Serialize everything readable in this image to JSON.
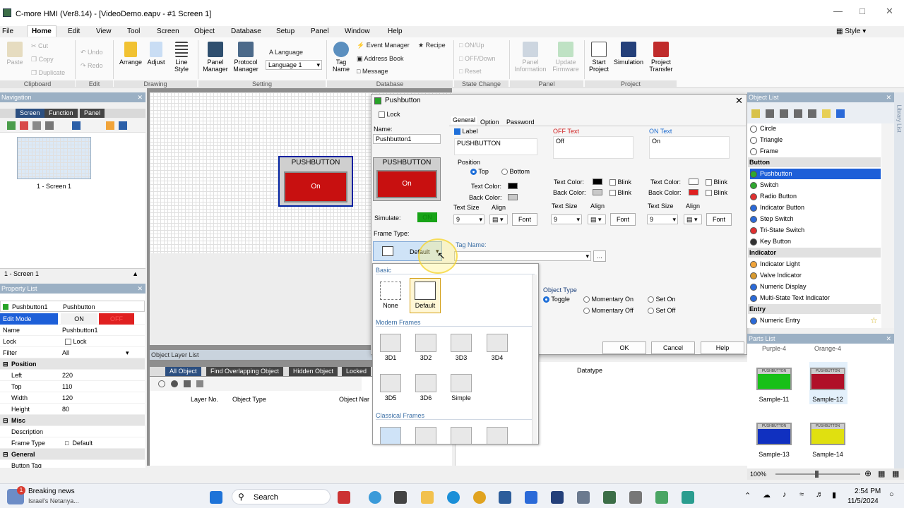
{
  "window": {
    "title": "C-more HMI (Ver8.14) - [VideoDemo.eapv - #1 Screen 1]",
    "style_label": "Style"
  },
  "menu": [
    "File",
    "Home",
    "Edit",
    "View",
    "Tool",
    "Screen",
    "Object",
    "Database",
    "Setup",
    "Panel",
    "Window",
    "Help"
  ],
  "ribbon": {
    "clipboard": {
      "paste": "Paste",
      "cut": "Cut",
      "copy": "Copy",
      "duplicate": "Duplicate",
      "label": "Clipboard"
    },
    "edit": {
      "undo": "Undo",
      "redo": "Redo",
      "label": "Edit"
    },
    "drawing": {
      "arrange": "Arrange",
      "adjust": "Adjust",
      "line_style": "Line Style",
      "label": "Drawing"
    },
    "setting": {
      "panel_manager": "Panel Manager",
      "protocol_manager": "Protocol Manager",
      "language_label": "Language",
      "language_value": "Language 1",
      "label": "Setting"
    },
    "database": {
      "tag_name": "Tag Name",
      "event_manager": "Event Manager",
      "recipe": "Recipe",
      "address_book": "Address Book",
      "message": "Message",
      "label": "Database"
    },
    "state_change": {
      "on_up": "ON/Up",
      "off_down": "OFF/Down",
      "reset": "Reset",
      "label": "State Change"
    },
    "panel": {
      "panel_info": "Panel Information",
      "update_fw": "Update Firmware",
      "label": "Panel"
    },
    "project": {
      "start": "Start Project",
      "simulation": "Simulation",
      "transfer": "Project Transfer",
      "label": "Project"
    }
  },
  "navigation": {
    "title": "Navigation",
    "tabs": [
      "Screen",
      "Function",
      "Panel"
    ],
    "thumb_label": "1 - Screen 1",
    "footer": "1 - Screen 1"
  },
  "property_list": {
    "title": "Property List",
    "object_name": "Pushbutton1",
    "object_type": "Pushbutton",
    "edit_mode_label": "Edit Mode",
    "edit_on": "ON",
    "edit_off": "OFF",
    "rows": [
      {
        "k": "Name",
        "v": "Pushbutton1"
      },
      {
        "k": "Lock",
        "v": "Lock"
      },
      {
        "k": "Filter",
        "v": "All"
      }
    ],
    "position_label": "Position",
    "position": [
      {
        "k": "Left",
        "v": "220"
      },
      {
        "k": "Top",
        "v": "110"
      },
      {
        "k": "Width",
        "v": "120"
      },
      {
        "k": "Height",
        "v": "80"
      }
    ],
    "misc_label": "Misc",
    "misc": [
      {
        "k": "Description",
        "v": ""
      },
      {
        "k": "Frame Type",
        "v": "Default"
      }
    ],
    "general_label": "General",
    "general_cut": "Button Tag"
  },
  "canvas_button": {
    "label": "PUSHBUTTON",
    "state": "On"
  },
  "object_layer": {
    "title": "Object Layer List",
    "tabs": [
      "All Object",
      "Find Overlapping Object",
      "Hidden Object",
      "Locked"
    ],
    "columns": [
      "Layer No.",
      "Object Type",
      "Object Nar"
    ],
    "datatype_col": "Datatype"
  },
  "dialog": {
    "title": "Pushbutton",
    "lock": "Lock",
    "name_label": "Name:",
    "name_value": "Pushbutton1",
    "preview_label": "PUSHBUTTON",
    "preview_state": "On",
    "simulate_label": "Simulate:",
    "simulate_state": "ON",
    "frame_type_label": "Frame Type:",
    "frame_type_value": "Default",
    "tabs": [
      "General",
      "Option",
      "Password"
    ],
    "label_check": "Label",
    "label_text": "PUSHBUTTON",
    "position_label": "Position",
    "pos_top": "Top",
    "pos_bottom": "Bottom",
    "text_color": "Text Color:",
    "back_color": "Back Color:",
    "text_size": "Text Size",
    "align": "Align",
    "size_value": "9",
    "font": "Font",
    "off_text_label": "OFF Text",
    "off_text": "Off",
    "on_text_label": "ON Text",
    "on_text": "On",
    "blink": "Blink",
    "tag_name_label": "Tag Name:",
    "object_type_label": "Object Type",
    "types": [
      "Toggle",
      "Momentary On",
      "Momentary Off",
      "Set On",
      "Set Off"
    ],
    "ok": "OK",
    "cancel": "Cancel",
    "help": "Help"
  },
  "frame_dropdown": {
    "basic_label": "Basic",
    "basic": [
      "None",
      "Default"
    ],
    "modern_label": "Modern Frames",
    "modern": [
      "3D1",
      "3D2",
      "3D3",
      "3D4",
      "3D5",
      "3D6",
      "Simple"
    ],
    "classical_label": "Classical Frames"
  },
  "object_list": {
    "title": "Object List",
    "items": [
      {
        "type": "item",
        "text": "Circle"
      },
      {
        "type": "item",
        "text": "Triangle"
      },
      {
        "type": "item",
        "text": "Frame"
      },
      {
        "type": "section",
        "text": "Button"
      },
      {
        "type": "item",
        "text": "Pushbutton",
        "selected": true
      },
      {
        "type": "item",
        "text": "Switch"
      },
      {
        "type": "item",
        "text": "Radio Button"
      },
      {
        "type": "item",
        "text": "Indicator Button"
      },
      {
        "type": "item",
        "text": "Step Switch"
      },
      {
        "type": "item",
        "text": "Tri-State Switch"
      },
      {
        "type": "item",
        "text": "Key Button"
      },
      {
        "type": "section",
        "text": "Indicator"
      },
      {
        "type": "item",
        "text": "Indicator Light"
      },
      {
        "type": "item",
        "text": "Valve Indicator"
      },
      {
        "type": "item",
        "text": "Numeric Display"
      },
      {
        "type": "item",
        "text": "Multi-State Text Indicator"
      },
      {
        "type": "section",
        "text": "Entry"
      },
      {
        "type": "item",
        "text": "Numeric Entry"
      }
    ]
  },
  "parts_list": {
    "title": "Parts List",
    "cut_labels": [
      "Purple-4",
      "Orange-4"
    ],
    "samples": [
      {
        "name": "Sample-11",
        "color": "#18c018",
        "label": "PUSHBUTTON"
      },
      {
        "name": "Sample-12",
        "color": "#b01028",
        "label": "PUSHBUTTON"
      },
      {
        "name": "Sample-13",
        "color": "#1030c0",
        "label": "PUSHBUTTON"
      },
      {
        "name": "Sample-14",
        "color": "#e0e010",
        "label": "PUSHBUTTON"
      }
    ]
  },
  "zoom": "100%",
  "taskbar": {
    "news_title": "Breaking news",
    "news_sub": "Israel's Netanya...",
    "news_badge": "1",
    "search": "Search",
    "time": "2:54 PM",
    "date": "11/5/2024"
  }
}
